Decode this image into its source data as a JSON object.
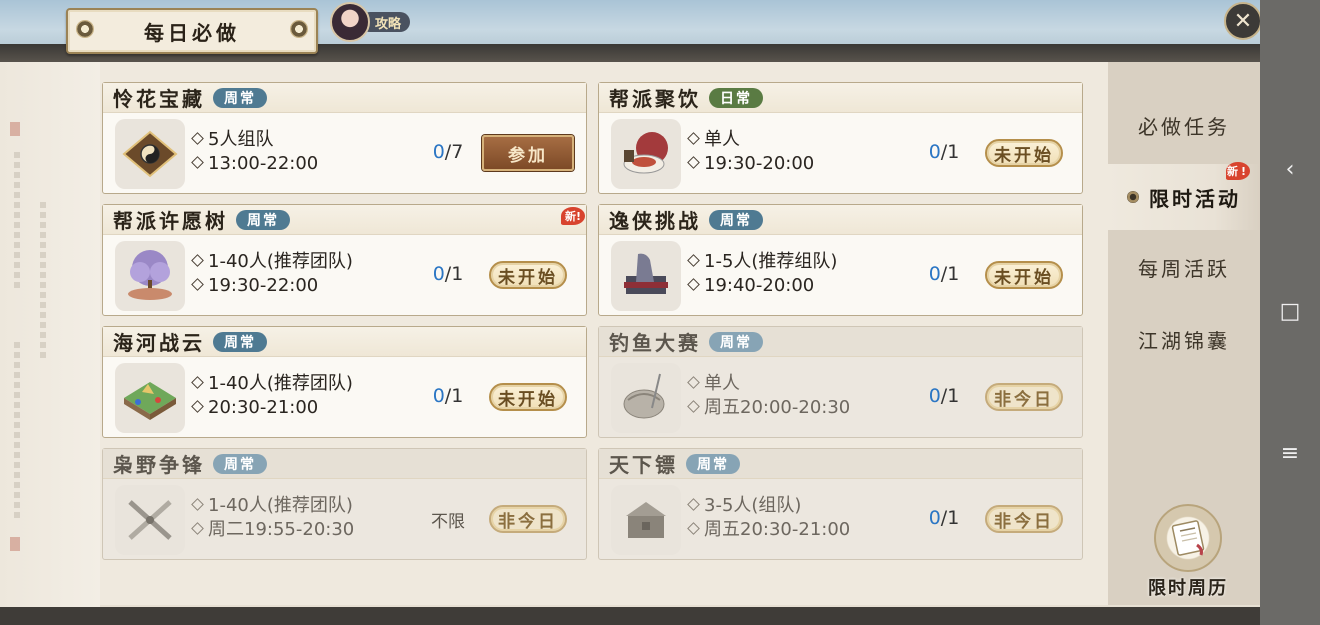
{
  "header": {
    "title": "每日必做",
    "guide_label": "攻略",
    "close_icon": "close-icon"
  },
  "activities": [
    {
      "name": "怜花宝藏",
      "tag": "周常",
      "tag_type": "weekly",
      "is_new": false,
      "dimmed": false,
      "icon": "treasure-board-icon",
      "team": "5人组队",
      "time": "13:00-22:00",
      "done": "0",
      "total": "/7",
      "limit": "",
      "button": "参加",
      "button_type": "join"
    },
    {
      "name": "帮派聚饮",
      "tag": "日常",
      "tag_type": "daily",
      "is_new": false,
      "dimmed": false,
      "icon": "feast-icon",
      "team": "单人",
      "time": "19:30-20:00",
      "done": "0",
      "total": "/1",
      "limit": "",
      "button": "未开始",
      "button_type": "pill"
    },
    {
      "name": "帮派许愿树",
      "tag": "周常",
      "tag_type": "weekly",
      "is_new": true,
      "dimmed": false,
      "icon": "wishing-tree-icon",
      "team": "1-40人(推荐团队)",
      "time": "19:30-22:00",
      "done": "0",
      "total": "/1",
      "limit": "",
      "button": "未开始",
      "button_type": "pill"
    },
    {
      "name": "逸侠挑战",
      "tag": "周常",
      "tag_type": "weekly",
      "is_new": false,
      "dimmed": false,
      "icon": "hero-challenge-icon",
      "team": "1-5人(推荐组队)",
      "time": "19:40-20:00",
      "done": "0",
      "total": "/1",
      "limit": "",
      "button": "未开始",
      "button_type": "pill"
    },
    {
      "name": "海河战云",
      "tag": "周常",
      "tag_type": "weekly",
      "is_new": false,
      "dimmed": false,
      "icon": "battle-map-icon",
      "team": "1-40人(推荐团队)",
      "time": "20:30-21:00",
      "done": "0",
      "total": "/1",
      "limit": "",
      "button": "未开始",
      "button_type": "pill"
    },
    {
      "name": "钓鱼大赛",
      "tag": "周常",
      "tag_type": "weekly",
      "is_new": false,
      "dimmed": true,
      "icon": "fishing-basket-icon",
      "team": "单人",
      "time": "周五20:00-20:30",
      "done": "0",
      "total": "/1",
      "limit": "",
      "button": "非今日",
      "button_type": "pill"
    },
    {
      "name": "枭野争锋",
      "tag": "周常",
      "tag_type": "weekly",
      "is_new": false,
      "dimmed": true,
      "icon": "crossed-swords-icon",
      "team": "1-40人(推荐团队)",
      "time": "周二19:55-20:30",
      "done": "",
      "total": "",
      "limit": "不限",
      "button": "非今日",
      "button_type": "pill"
    },
    {
      "name": "天下镖",
      "tag": "周常",
      "tag_type": "weekly",
      "is_new": false,
      "dimmed": true,
      "icon": "cargo-chest-icon",
      "team": "3-5人(组队)",
      "time": "周五20:30-21:00",
      "done": "0",
      "total": "/1",
      "limit": "",
      "button": "非今日",
      "button_type": "pill"
    }
  ],
  "new_badge": "新!",
  "tabs": [
    {
      "label": "必做任务",
      "active": false
    },
    {
      "label": "限时活动",
      "active": true,
      "is_new": true
    },
    {
      "label": "每周活跃",
      "active": false
    },
    {
      "label": "江湖锦囊",
      "active": false
    }
  ],
  "calendar": {
    "label": "限时周历",
    "icon": "calendar-scroll-icon"
  },
  "system_nav": [
    "back-icon",
    "home-icon",
    "menu-icon"
  ]
}
